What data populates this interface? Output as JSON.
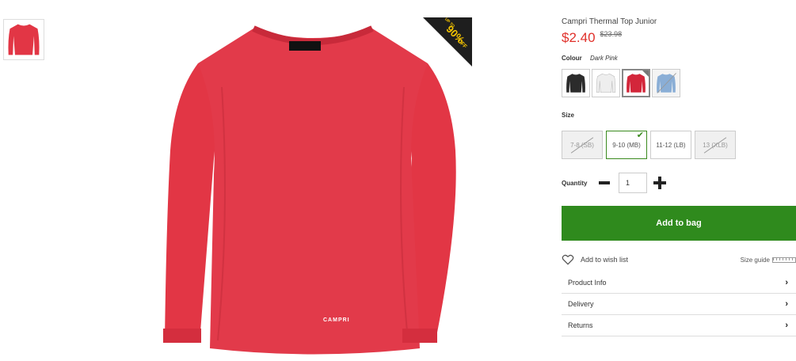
{
  "product": {
    "title": "Campri Thermal Top Junior",
    "price": "$2.40",
    "was_price": "$23.98",
    "colour_label": "Colour",
    "colour_value": "Dark Pink",
    "garment_colour": "#e23645",
    "logo_text": "CAMPRI",
    "promo": {
      "top": "UP TO",
      "main": "90%",
      "sub": "OFF",
      "color": "#f5c400"
    }
  },
  "swatches": [
    {
      "name": "Black",
      "color": "#2b2b2b"
    },
    {
      "name": "White",
      "color": "#f2f2f2"
    },
    {
      "name": "Dark Pink",
      "color": "#d3263a"
    },
    {
      "name": "Blue",
      "color": "#8aaed6"
    }
  ],
  "size": {
    "label": "Size",
    "options": [
      "7-8 (SB)",
      "9-10 (MB)",
      "11-12 (LB)",
      "13 (XLB)"
    ]
  },
  "quantity": {
    "label": "Quantity",
    "value": "1"
  },
  "actions": {
    "add_to_bag": "Add to bag",
    "wish_list": "Add to wish list",
    "size_guide": "Size guide"
  },
  "accordion": [
    "Product Info",
    "Delivery",
    "Returns"
  ],
  "colors": {
    "accent_green": "#2f8a1d",
    "price_red": "#e0312b"
  }
}
